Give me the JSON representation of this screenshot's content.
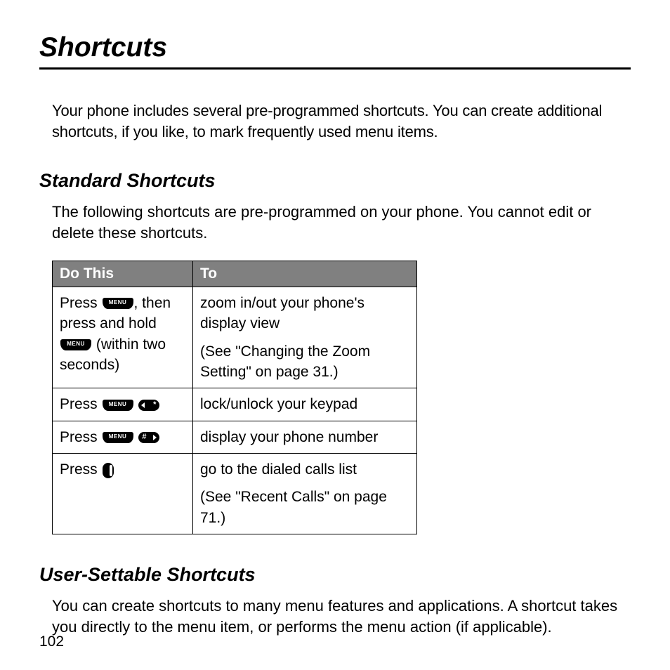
{
  "title": "Shortcuts",
  "intro": "Your phone includes several pre-programmed shortcuts. You can create additional shortcuts, if you like, to mark frequently used menu items.",
  "section1": {
    "heading": "Standard Shortcuts",
    "para": "The following shortcuts are pre-programmed on your phone. You cannot edit or delete these shortcuts."
  },
  "table": {
    "head_do": "Do This",
    "head_to": "To",
    "rows": [
      {
        "do_pre": "Press ",
        "do_mid": ", then press and hold ",
        "do_post": " (within two seconds)",
        "to1": "zoom in/out your phone's display view",
        "to2": "(See \"Changing the Zoom Setting\" on page 31.)"
      },
      {
        "do_pre": "Press ",
        "to1": "lock/unlock your keypad"
      },
      {
        "do_pre": "Press ",
        "to1": "display your phone number"
      },
      {
        "do_pre": "Press ",
        "to1": "go to the dialed calls list",
        "to2": "(See \"Recent Calls\" on page 71.)"
      }
    ]
  },
  "section2": {
    "heading": "User-Settable Shortcuts",
    "para": "You can create shortcuts to many menu features and applications. A shortcut takes you directly to the menu item, or performs the menu action (if applicable)."
  },
  "page_number": "102"
}
